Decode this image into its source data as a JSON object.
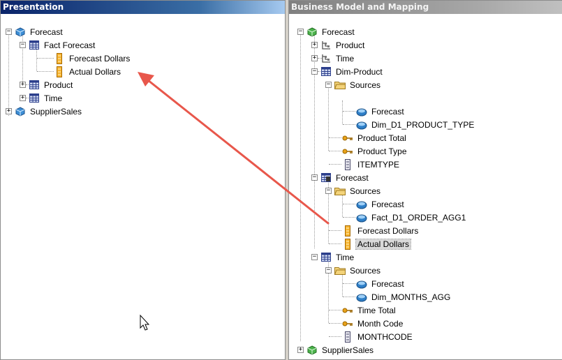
{
  "presentation": {
    "title": "Presentation",
    "tree": {
      "forecast": "Forecast",
      "fact_forecast": "Fact Forecast",
      "forecast_dollars": "Forecast Dollars",
      "actual_dollars": "Actual Dollars",
      "product": "Product",
      "time": "Time",
      "supplier_sales": "SupplierSales"
    }
  },
  "bmm": {
    "title": "Business Model and Mapping",
    "tree": {
      "forecast": "Forecast",
      "product": "Product",
      "time": "Time",
      "dim_product": "Dim-Product",
      "sources1": "Sources",
      "src_forecast1": "Forecast",
      "src_dim_d1": "Dim_D1_PRODUCT_TYPE",
      "product_total": "Product Total",
      "product_type": "Product Type",
      "itemtype": "ITEMTYPE",
      "forecast_fact": "Forecast",
      "sources2": "Sources",
      "src_forecast2": "Forecast",
      "src_fact_d1": "Fact_D1_ORDER_AGG1",
      "forecast_dollars": "Forecast Dollars",
      "actual_dollars": "Actual Dollars",
      "time_dim": "Time",
      "sources3": "Sources",
      "src_forecast3": "Forecast",
      "src_dim_months": "Dim_MONTHS_AGG",
      "time_total": "Time Total",
      "month_code": "Month Code",
      "monthcode": "MONTHCODE",
      "supplier_sales": "SupplierSales"
    }
  },
  "colors": {
    "title_active": "#0a246a",
    "title_inactive": "#808080",
    "arrow": "#e8574b",
    "selection": "#d9d9d9"
  },
  "icons": {
    "cube": "cube-icon",
    "table": "table-icon",
    "column": "column-icon",
    "hierarchy": "hierarchy-icon",
    "folder": "folder-icon",
    "source": "source-icon",
    "key": "key-icon",
    "physical_column": "physical-column-icon"
  }
}
